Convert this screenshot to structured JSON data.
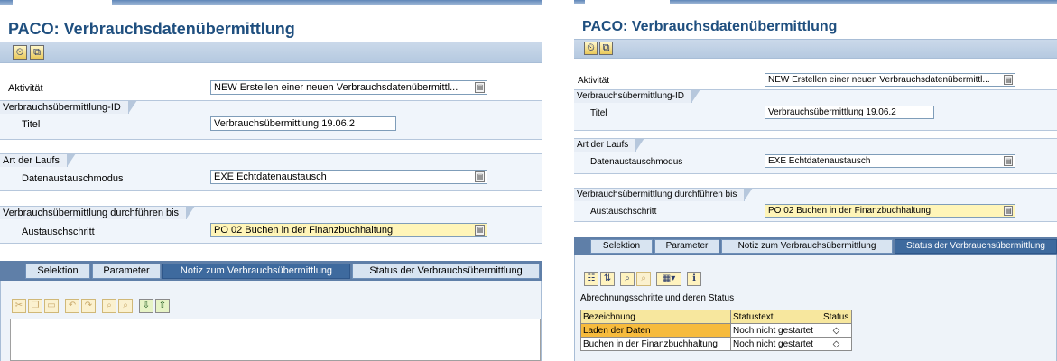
{
  "title": "PACO: Verbrauchsdatenübermittlung",
  "toolbar": {
    "buttons": [
      {
        "icon": "execute-clock-icon",
        "glyph": "⏲"
      },
      {
        "icon": "copy-docs-icon",
        "glyph": "⧉"
      }
    ]
  },
  "fields": {
    "aktivitaet_label": "Aktivität",
    "aktivitaet_value": "NEW Erstellen einer neuen Verbrauchsdatenübermittl...",
    "group_id": "Verbrauchsübermittlung-ID",
    "titel_label": "Titel",
    "titel_value": "Verbrauchsübermittlung 19.06.2",
    "group_art": "Art der Laufs",
    "modus_label": "Datenaustauschmodus",
    "modus_value": "EXE Echtdatenaustausch",
    "group_durchf": "Verbrauchsübermittlung durchführen bis",
    "schritt_label": "Austauschschritt",
    "schritt_value": "PO 02 Buchen in der Finanzbuchhaltung"
  },
  "tabs": {
    "selektion": "Selektion",
    "parameter": "Parameter",
    "notiz": "Notiz zum Verbrauchsübermittlung",
    "status": "Status der Verbrauchsübermittlung"
  },
  "editor_icons": [
    "cut-icon",
    "copy-icon",
    "paste-icon",
    "undo-icon",
    "redo-icon",
    "find-icon",
    "find-next-icon",
    "load-icon",
    "save-icon"
  ],
  "status_section": {
    "toolbar_icons": [
      "details-icon",
      "sort-icon",
      "find-icon",
      "find-next-icon",
      "layout-icon",
      "info-icon"
    ],
    "caption": "Abrechnungsschritte und deren Status",
    "columns": [
      "Bezeichnung",
      "Statustext",
      "Status"
    ],
    "rows": [
      {
        "bezeichnung": "Laden der Daten",
        "statustext": "Noch nicht gestartet",
        "status": "◇"
      },
      {
        "bezeichnung": "Buchen in der Finanzbuchhaltung",
        "statustext": "Noch nicht gestartet",
        "status": "◇"
      }
    ]
  },
  "colors": {
    "title": "#1f4f7f",
    "toolbar": "#b5c9e0",
    "active_tab": "#3e6a9e",
    "highlight_field": "#fff5b8",
    "selected_cell": "#f7bb3d"
  }
}
